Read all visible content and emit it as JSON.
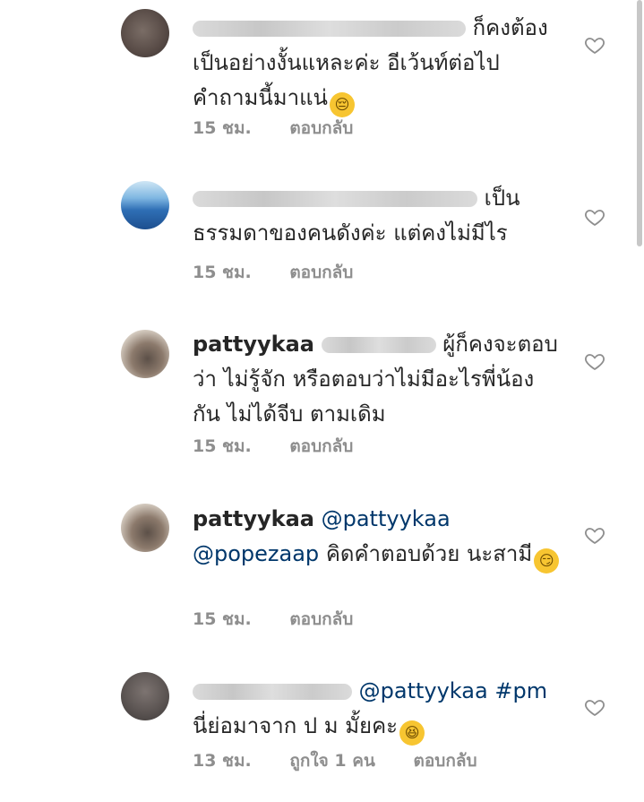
{
  "comments": [
    {
      "text": "ก็คงต้อง เป็นอย่างงั้นแหละค่ะ อีเว้นท์ต่อไป คำถามนี้มาแน่",
      "emoji": "😔",
      "time": "15 ชม.",
      "reply": "ตอบกลับ"
    },
    {
      "text": "เป็น ธรรมดาของคนดังค่ะ แต่คงไม่มีไร",
      "time": "15 ชม.",
      "reply": "ตอบกลับ"
    },
    {
      "username": "pattyykaa",
      "text": "ผู้ก็คงจะตอบ ว่า ไม่รู้จัก หรือตอบว่าไม่มีอะไรพี่น้อง กัน ไม่ได้จีบ ตามเดิม",
      "time": "15 ชม.",
      "reply": "ตอบกลับ"
    },
    {
      "username": "pattyykaa",
      "mention1": "@pattyykaa",
      "mention2": "@popezaap",
      "text": "คิดคำตอบด้วย นะสามี",
      "emoji": "😏",
      "time": "15 ชม.",
      "reply": "ตอบกลับ"
    },
    {
      "mention1": "@pattyykaa",
      "hashtag": "#pm",
      "text": "นี่ย่อมาจาก ป ม มั้ยคะ",
      "emoji": "😆",
      "time": "13 ชม.",
      "likes": "ถูกใจ 1 คน",
      "reply": "ตอบกลับ"
    }
  ],
  "icons": {
    "like": "heart-outline-icon"
  },
  "colors": {
    "text": "#262626",
    "meta": "#8e8e8e",
    "mention": "#00376b"
  }
}
